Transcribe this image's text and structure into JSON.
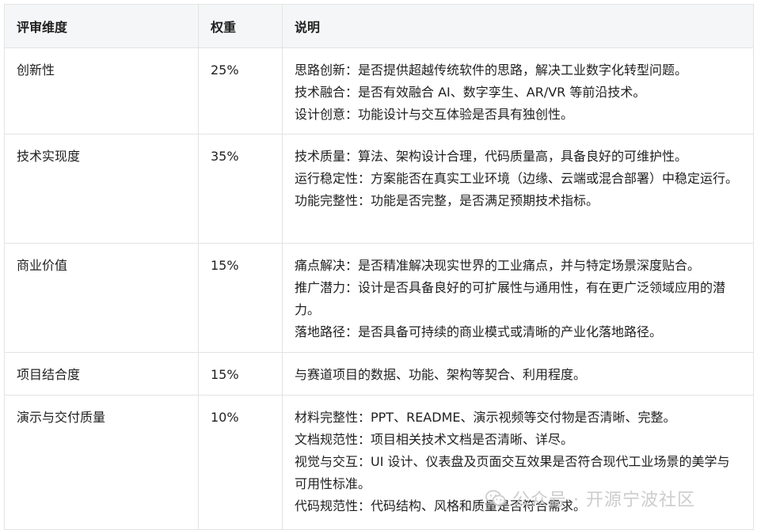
{
  "table": {
    "headers": [
      "评审维度",
      "权重",
      "说明"
    ],
    "rows": [
      {
        "dimension": "创新性",
        "weight": "25%",
        "lines": [
          "思路创新：是否提供超越传统软件的思路，解决工业数字化转型问题。",
          "技术融合：是否有效融合 AI、数字孪生、AR/VR 等前沿技术。",
          "设计创意：功能设计与交互体验是否具有独创性。"
        ]
      },
      {
        "dimension": "技术实现度",
        "weight": "35%",
        "lines": [
          "技术质量：算法、架构设计合理，代码质量高，具备良好的可维护性。",
          "运行稳定性：方案能否在真实工业环境（边缘、云端或混合部署）中稳定运行。",
          "功能完整性：功能是否完整，是否满足预期技术指标。"
        ]
      },
      {
        "dimension": "商业价值",
        "weight": "15%",
        "lines": [
          "痛点解决：是否精准解决现实世界的工业痛点，并与特定场景深度贴合。",
          "推广潜力：设计是否具备良好的可扩展性与通用性，有在更广泛领域应用的潜力。",
          "落地路径：是否具备可持续的商业模式或清晰的产业化落地路径。"
        ]
      },
      {
        "dimension": "项目结合度",
        "weight": "15%",
        "lines": [
          "与赛道项目的数据、功能、架构等契合、利用程度。"
        ]
      },
      {
        "dimension": "演示与交付质量",
        "weight": "10%",
        "lines": [
          "材料完整性：PPT、README、演示视频等交付物是否清晰、完整。",
          "文档规范性：项目相关技术文档是否清晰、详尽。",
          "视觉与交互：UI 设计、仪表盘及页面交互效果是否符合现代工业场景的美学与可用性标准。",
          "代码规范性：代码结构、风格和质量是否符合需求。"
        ]
      }
    ]
  },
  "watermark": {
    "text": "公众号 · 开源宁波社区",
    "icon": "wechat-logo-icon",
    "color": "#c8c8c8"
  }
}
